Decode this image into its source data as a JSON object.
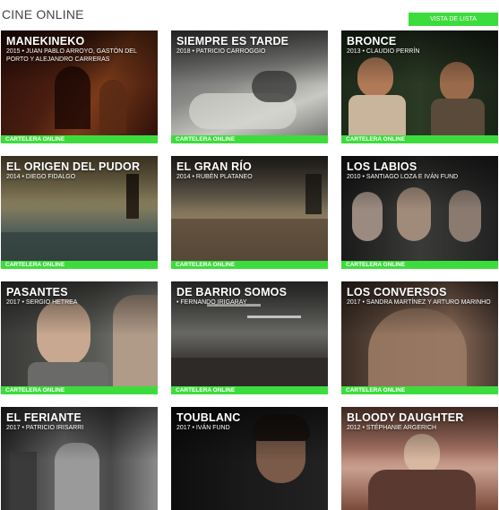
{
  "header": {
    "title": "CINE ONLINE",
    "view_toggle_label": "VISTA DE LISTA"
  },
  "colors": {
    "accent": "#3ddc3d"
  },
  "films": [
    {
      "title": "MANEKINEKO",
      "meta": "2015 • JUAN PABLO ARROYO, GASTÓN DEL PORTO Y ALEJANDRO CARRERAS",
      "badge": "CARTELERA ONLINE"
    },
    {
      "title": "SIEMPRE ES TARDE",
      "meta": "2018 • PATRICIO CARROGGIO",
      "badge": "CARTELERA ONLINE"
    },
    {
      "title": "BRONCE",
      "meta": "2013 • CLAUDIO PERRÍN",
      "badge": "CARTELERA ONLINE"
    },
    {
      "title": "EL ORIGEN DEL PUDOR",
      "meta": "2014 • DIEGO FIDALGO",
      "badge": "CARTELERA ONLINE"
    },
    {
      "title": "EL GRAN RÍO",
      "meta": "2014 • RUBÉN PLATANEO",
      "badge": "CARTELERA ONLINE"
    },
    {
      "title": "LOS LABIOS",
      "meta": "2010 • SANTIAGO LOZA E IVÁN FUND",
      "badge": "CARTELERA ONLINE"
    },
    {
      "title": "PASANTES",
      "meta": "2017 • SERGIO HETREA",
      "badge": "CARTELERA ONLINE"
    },
    {
      "title": "DE BARRIO SOMOS",
      "meta": "• FERNANDO IRIGARAY",
      "badge": "CARTELERA ONLINE"
    },
    {
      "title": "LOS CONVERSOS",
      "meta": "2017 • SANDRA MARTÍNEZ Y ARTURO MARINHO",
      "badge": "CARTELERA ONLINE"
    },
    {
      "title": "EL FERIANTE",
      "meta": "2017 • PATRICIO IRISARRI",
      "badge": ""
    },
    {
      "title": "TOUBLANC",
      "meta": "2017 • IVÁN FUND",
      "badge": ""
    },
    {
      "title": "BLOODY DAUGHTER",
      "meta": "2012 • STÉPHANIE ARGERICH",
      "badge": ""
    }
  ]
}
